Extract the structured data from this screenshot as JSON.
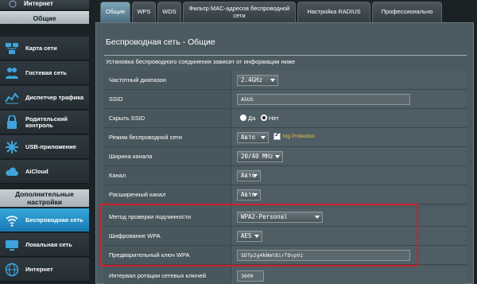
{
  "sidebar": {
    "top_label": "Интернет",
    "group_general": "Общие",
    "items": [
      {
        "label": "Карта сети",
        "icon": "network-map-icon"
      },
      {
        "label": "Гостевая сеть",
        "icon": "guest-network-icon"
      },
      {
        "label": "Диспетчер трафика",
        "icon": "traffic-manager-icon"
      },
      {
        "label": "Родительский контроль",
        "icon": "parental-control-icon"
      },
      {
        "label": "USB-приложение",
        "icon": "usb-app-icon"
      },
      {
        "label": "AiCloud",
        "icon": "aicloud-icon"
      }
    ],
    "group_advanced": "Дополнительные настройки",
    "adv_items": [
      {
        "label": "Беспроводная сеть",
        "icon": "wireless-icon",
        "active": true
      },
      {
        "label": "Локальная сеть",
        "icon": "lan-icon"
      },
      {
        "label": "Интернет",
        "icon": "internet-icon"
      }
    ]
  },
  "tabs": [
    "Общие",
    "WPS",
    "WDS",
    "Фильтр MAC-адресов беспроводной сети",
    "Настройка RADIUS",
    "Профессионально"
  ],
  "page": {
    "title": "Беспроводная сеть - Общие",
    "notice": "Установка беспроводного соединения зависит от информации ниже"
  },
  "fields": {
    "band": {
      "label": "Частотный диапазон",
      "value": "2.4GHz"
    },
    "ssid": {
      "label": "SSID",
      "value": "ASUS"
    },
    "hide_ssid": {
      "label": "Скрыть SSID",
      "yes": "Да",
      "no": "Нет"
    },
    "wireless_mode": {
      "label": "Режим беспроводной сети",
      "value": "Авто",
      "protection": "b/g Protection"
    },
    "channel_width": {
      "label": "Ширина канала",
      "value": "20/40 MHz"
    },
    "channel": {
      "label": "Канал",
      "value": "Авто"
    },
    "ext_channel": {
      "label": "Расширенный канал",
      "value": "Авто"
    },
    "auth_method": {
      "label": "Метод проверки подлинности",
      "value": "WPA2-Personal"
    },
    "wpa_encryption": {
      "label": "Шифрование WPA",
      "value": "AES"
    },
    "wpa_key": {
      "label": "Предварительный ключ WPA",
      "value": "SDTp2g4kNmt8irTDvpVz"
    },
    "key_rotation": {
      "label": "Интервал ротации сетевых ключей",
      "value": "3600"
    }
  },
  "colors": {
    "highlight": "#d01f2c",
    "active_item": "#2a90c8",
    "protection_text": "#f2c534"
  }
}
